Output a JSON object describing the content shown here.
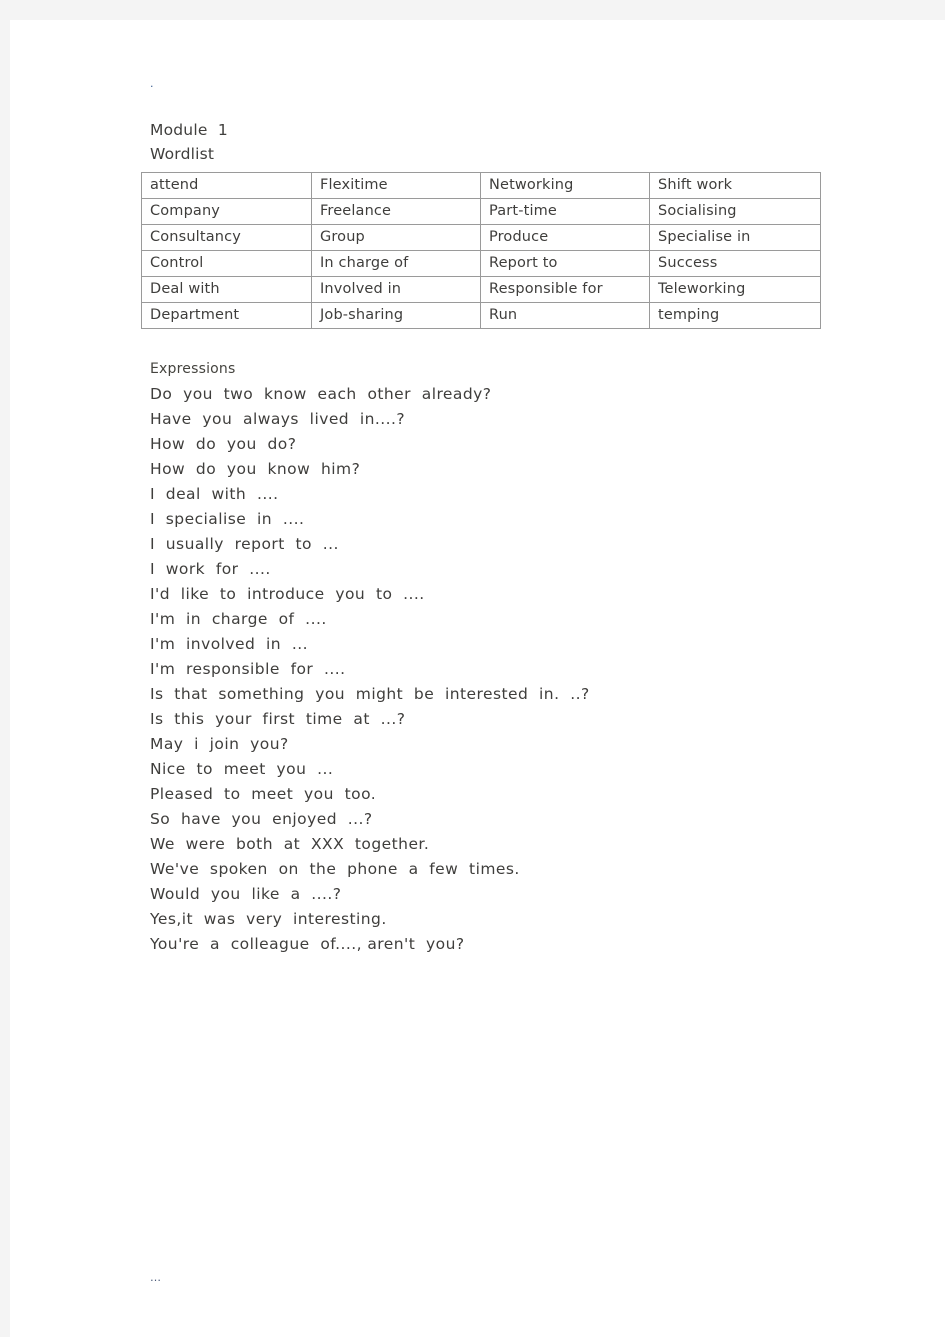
{
  "document": {
    "stray_mark_top": ".",
    "module_title": "Module  1",
    "section_title": "Wordlist",
    "footer_mark": "…"
  },
  "wordlist": {
    "rows": [
      [
        "attend",
        "Flexitime",
        "Networking",
        "Shift  work"
      ],
      [
        "Company",
        "Freelance",
        "Part-time",
        "Socialising"
      ],
      [
        "Consultancy",
        "Group",
        "Produce",
        "Specialise  in"
      ],
      [
        "Control",
        "In  charge  of",
        "Report  to",
        "Success"
      ],
      [
        "Deal  with",
        "Involved  in",
        "Responsible  for",
        "Teleworking"
      ],
      [
        "Department",
        "Job-sharing",
        "Run",
        "temping"
      ]
    ]
  },
  "expressions": {
    "heading": "Expressions",
    "lines": [
      "Do  you  two  know  each  other  already?",
      "Have  you  always  lived  in....?",
      "How  do  you  do?",
      "How  do  you  know  him?",
      "I  deal  with  ....",
      "I  specialise  in  ....",
      "I  usually  report  to  ...",
      "I  work  for  ....",
      "I'd  like  to  introduce  you  to  ....",
      "I'm  in  charge  of  ....",
      "I'm  involved  in  ...",
      "I'm  responsible  for  ....",
      "Is  that  something  you  might  be  interested  in.  ..?",
      "Is  this  your  first  time  at  ...?",
      "May  i  join  you?",
      "Nice  to  meet  you  ...",
      "Pleased  to  meet  you  too.",
      "So  have  you  enjoyed  ...?",
      "We  were  both  at  XXX  together.",
      "We've  spoken  on  the  phone  a  few  times.",
      "Would  you  like  a  ....?",
      "Yes,it  was  very  interesting.",
      "You're  a  colleague  of...., aren't  you?"
    ]
  },
  "colors": {
    "page_background": "#f4f4f4",
    "sheet": "#ffffff",
    "text": "#3f3e3c",
    "table_border": "#9a9a9a"
  }
}
